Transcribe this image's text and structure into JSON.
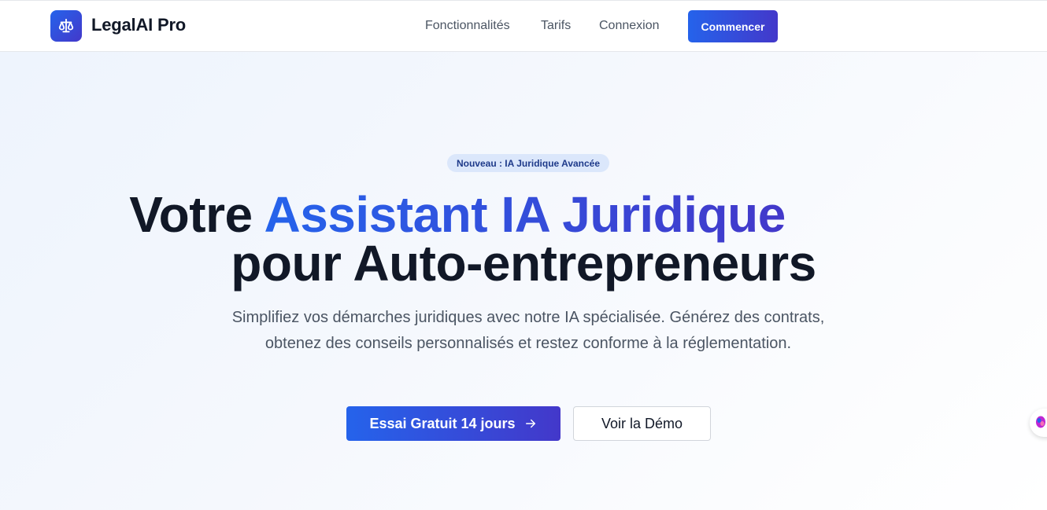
{
  "header": {
    "brand": "LegalAI Pro",
    "logo_icon": "scale-icon",
    "nav": {
      "features": "Fonctionnalités",
      "pricing": "Tarifs",
      "login": "Connexion"
    },
    "cta": "Commencer"
  },
  "hero": {
    "badge": "Nouveau : IA Juridique Avancée",
    "title_prefix": "Votre ",
    "title_highlight": "Assistant IA Juridique",
    "title_line2": "pour Auto-entrepreneurs",
    "subtitle": "Simplifiez vos démarches juridiques avec notre IA spécialisée. Générez des contrats, obtenez des conseils personnalisés et restez conforme à la réglementation.",
    "primary_cta": "Essai Gratuit 14 jours",
    "primary_cta_icon": "arrow-right-icon",
    "secondary_cta": "Voir la Démo"
  },
  "floating_widget": {
    "icon": "brain-icon"
  },
  "colors": {
    "accent_start": "#2563eb",
    "accent_end": "#4338ca",
    "text_dark": "#111827",
    "text_muted": "#4b5563",
    "badge_bg": "#dbe7fb"
  }
}
